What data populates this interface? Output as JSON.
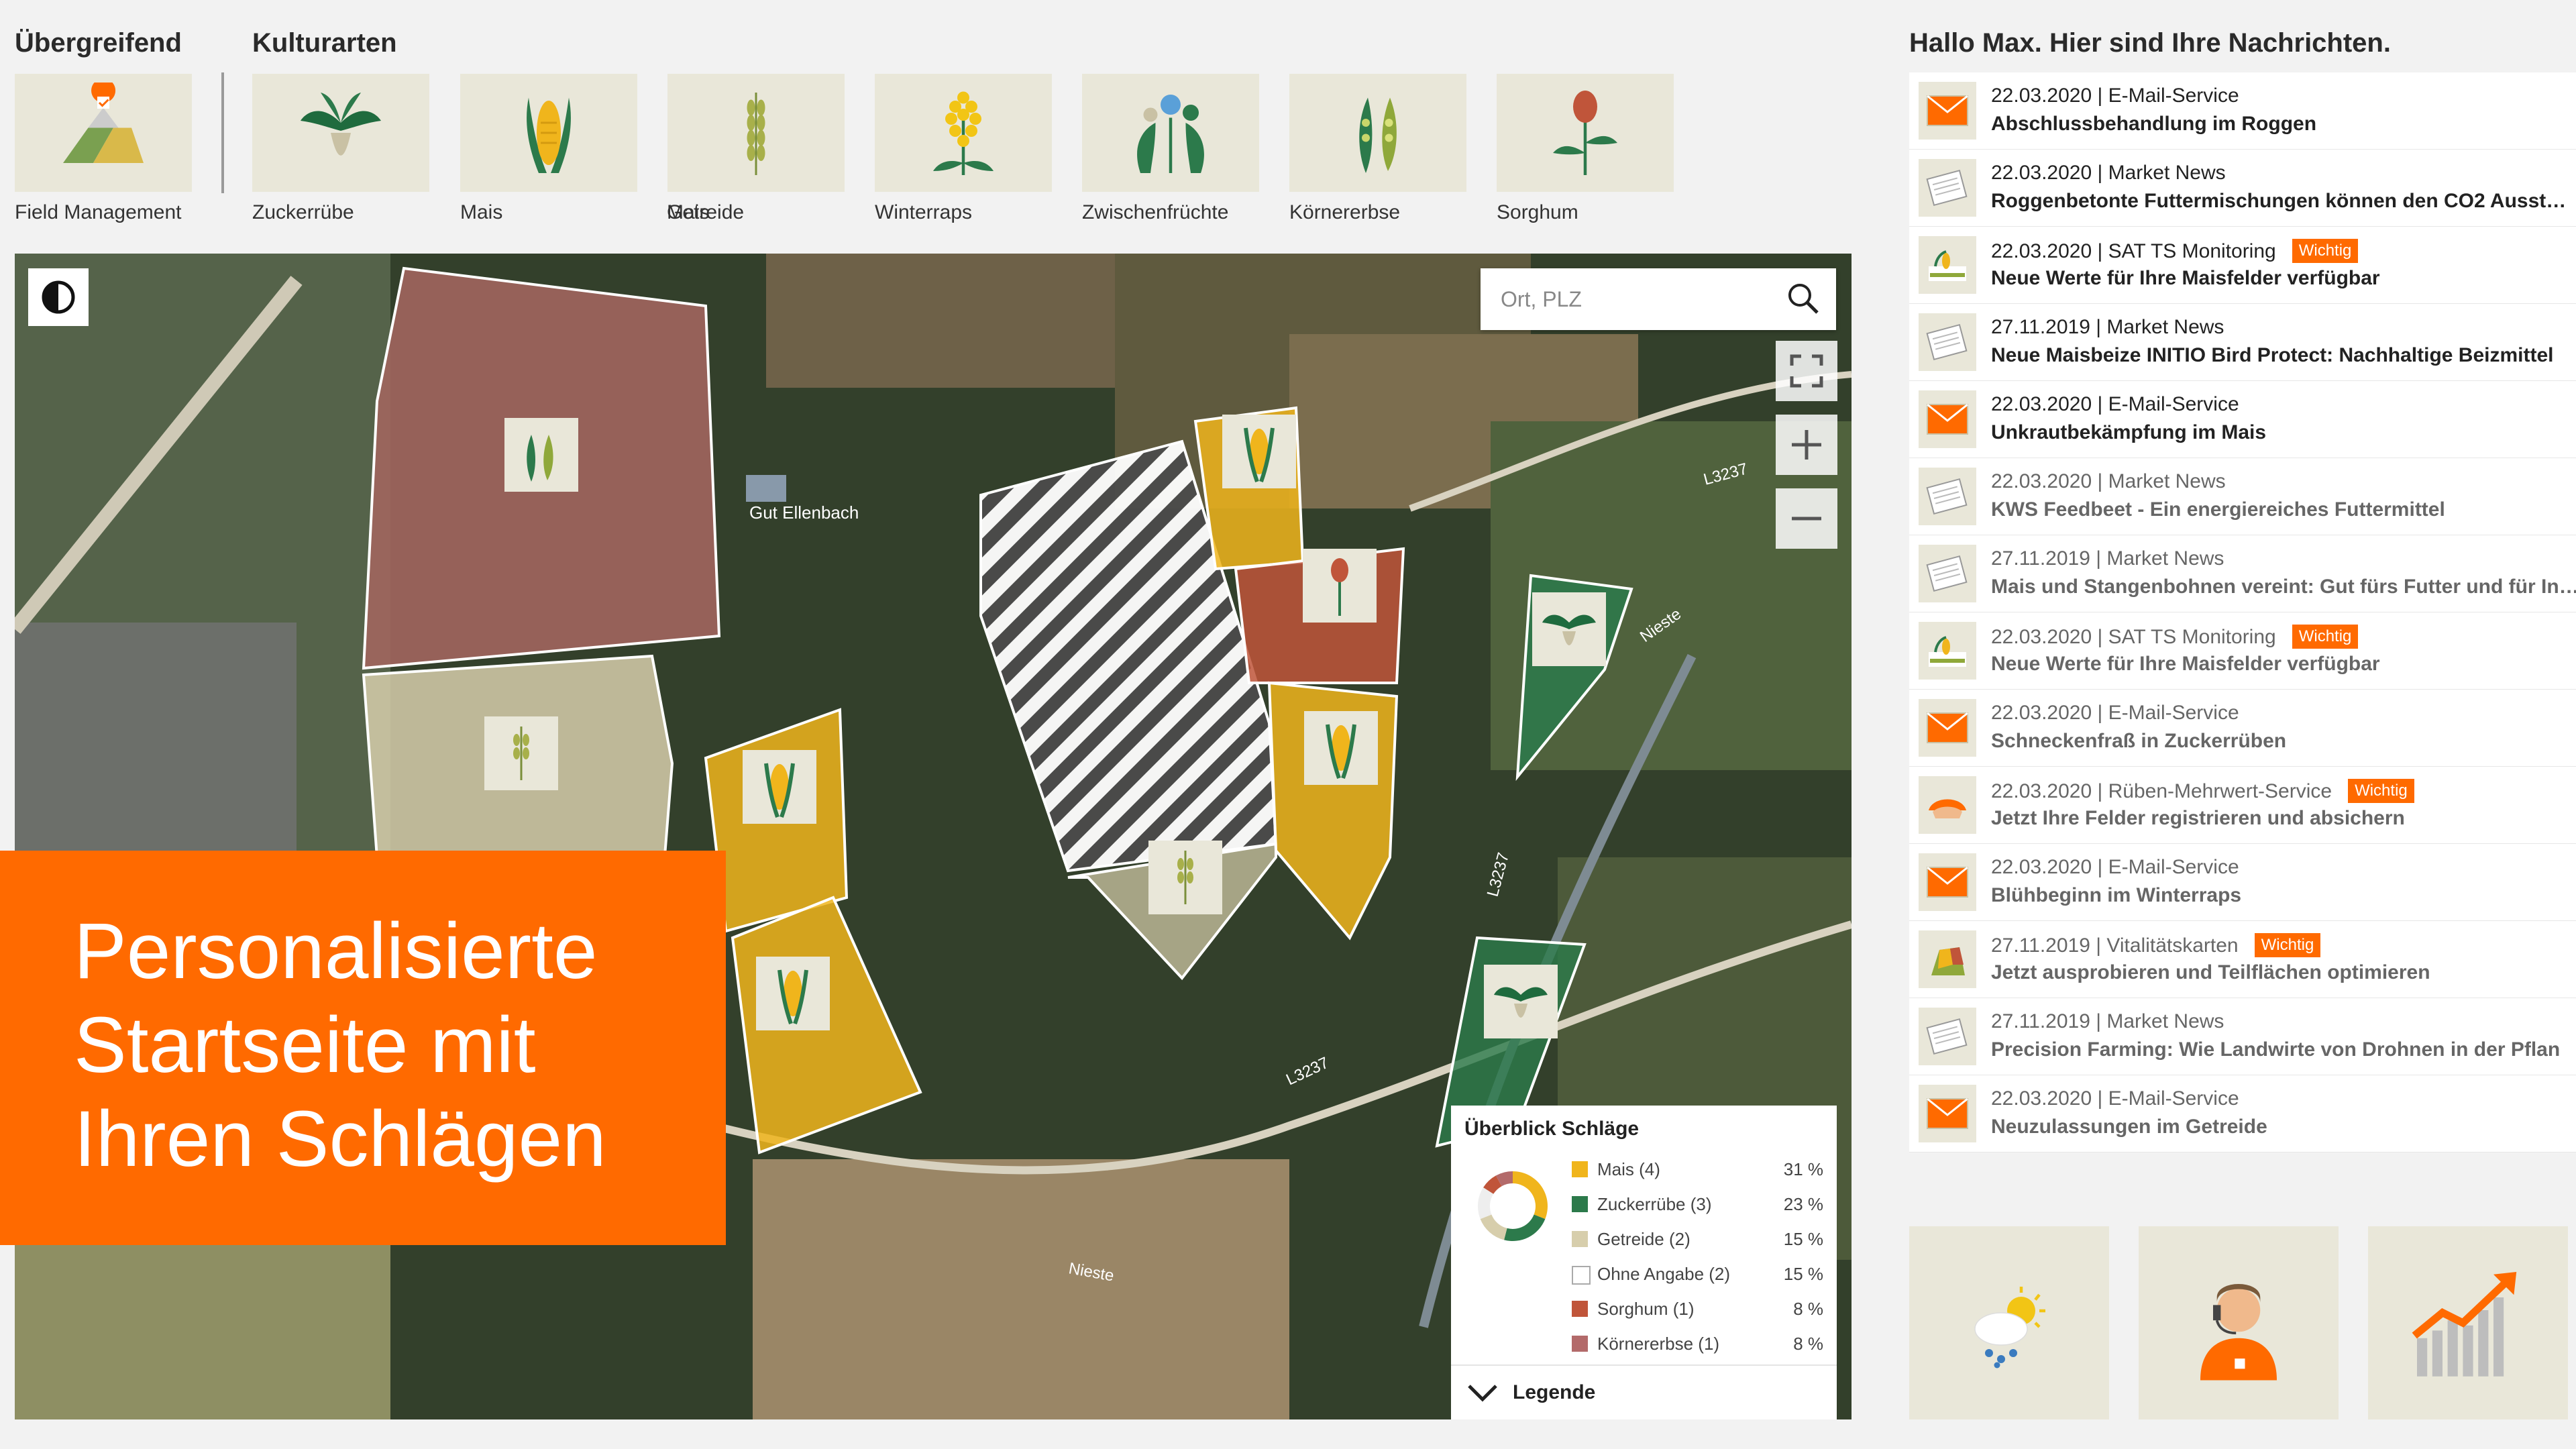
{
  "sections": {
    "overall_title": "Übergreifend",
    "cultures_title": "Kulturarten"
  },
  "tiles": [
    {
      "label": "Field Management",
      "icon": "field-management-icon"
    },
    {
      "label": "Zuckerrübe",
      "icon": "sugar-beet-icon"
    },
    {
      "label": "Mais",
      "icon": "corn-icon"
    },
    {
      "label": "Getreide",
      "icon": "grain-icon"
    },
    {
      "label": "Winterraps",
      "icon": "rapeseed-icon"
    },
    {
      "label": "Zwischenfrüchte",
      "icon": "cover-crop-icon"
    },
    {
      "label": "Körnererbse",
      "icon": "pea-icon"
    },
    {
      "label": "Sorghum",
      "icon": "sorghum-icon"
    }
  ],
  "map": {
    "search_placeholder": "Ort, PLZ",
    "place_labels": [
      "Gut Ellenbach",
      "L3237",
      "L3237",
      "L3237",
      "Nieste",
      "Nieste"
    ],
    "legend": {
      "title": "Überblick Schläge",
      "footer": "Legende",
      "items": [
        {
          "name": "Mais (4)",
          "pct": "31 %",
          "color": "#f0b51c"
        },
        {
          "name": "Zuckerrübe (3)",
          "pct": "23 %",
          "color": "#2c7a4b"
        },
        {
          "name": "Getreide (2)",
          "pct": "15 %",
          "color": "#d7ceac"
        },
        {
          "name": "Ohne Angabe (2)",
          "pct": "15 %",
          "color": "#ffffff"
        },
        {
          "name": "Sorghum (1)",
          "pct": "8 %",
          "color": "#c0553a"
        },
        {
          "name": "Körnererbse (1)",
          "pct": "8 %",
          "color": "#b36a6a"
        }
      ]
    }
  },
  "promo": {
    "line1": "Personalisierte",
    "line2": "Startseite mit",
    "line3": "Ihren Schlägen"
  },
  "messages": {
    "title": "Hallo Max. Hier sind Ihre Nachrichten.",
    "items": [
      {
        "meta": "22.03.2020 | E-Mail-Service",
        "subject": "Abschlussbehandlung im Roggen",
        "badge": "",
        "icon": "mail-icon",
        "read": false
      },
      {
        "meta": "22.03.2020 | Market News",
        "subject": "Roggenbetonte Futtermischungen können den CO2 Ausst…",
        "badge": "",
        "icon": "newspaper-icon",
        "read": false
      },
      {
        "meta": "22.03.2020 | SAT TS Monitoring",
        "subject": "Neue Werte für Ihre Maisfelder verfügbar",
        "badge": "Wichtig",
        "icon": "satellite-monitoring-icon",
        "read": false
      },
      {
        "meta": "27.11.2019 | Market News",
        "subject": "Neue Maisbeize INITIO Bird Protect: Nachhaltige Beizmittel",
        "badge": "",
        "icon": "newspaper-icon",
        "read": false
      },
      {
        "meta": "22.03.2020 | E-Mail-Service",
        "subject": "Unkrautbekämpfung im Mais",
        "badge": "",
        "icon": "mail-icon",
        "read": false
      },
      {
        "meta": "22.03.2020 | Market News",
        "subject": "KWS Feedbeet - Ein energiereiches Futtermittel",
        "badge": "",
        "icon": "newspaper-icon",
        "read": true
      },
      {
        "meta": "27.11.2019 | Market News",
        "subject": "Mais und Stangenbohnen vereint: Gut fürs Futter und für In…",
        "badge": "",
        "icon": "newspaper-icon",
        "read": true
      },
      {
        "meta": "22.03.2020 | SAT TS Monitoring",
        "subject": "Neue Werte für Ihre Maisfelder verfügbar",
        "badge": "Wichtig",
        "icon": "satellite-monitoring-icon",
        "read": true
      },
      {
        "meta": "22.03.2020 | E-Mail-Service",
        "subject": "Schneckenfraß in Zuckerrüben",
        "badge": "",
        "icon": "mail-icon",
        "read": true
      },
      {
        "meta": "22.03.2020 | Rüben-Mehrwert-Service",
        "subject": "Jetzt Ihre Felder registrieren und absichern",
        "badge": "Wichtig",
        "icon": "umbrella-icon",
        "read": true
      },
      {
        "meta": "22.03.2020 | E-Mail-Service",
        "subject": "Blühbeginn im Winterraps",
        "badge": "",
        "icon": "mail-icon",
        "read": true
      },
      {
        "meta": "27.11.2019 | Vitalitätskarten",
        "subject": "Jetzt ausprobieren und Teilflächen optimieren",
        "badge": "Wichtig",
        "icon": "vitality-map-icon",
        "read": true
      },
      {
        "meta": "27.11.2019 | Market News",
        "subject": "Precision Farming: Wie Landwirte von Drohnen in der Pflan",
        "badge": "",
        "icon": "newspaper-icon",
        "read": true
      },
      {
        "meta": "22.03.2020 | E-Mail-Service",
        "subject": "Neuzulassungen im Getreide",
        "badge": "",
        "icon": "mail-icon",
        "read": true
      }
    ]
  },
  "bottom_tiles": [
    {
      "icon": "weather-icon"
    },
    {
      "icon": "support-agent-icon"
    },
    {
      "icon": "market-chart-icon"
    }
  ],
  "colors": {
    "accent": "#ff6a00",
    "tile_bg": "#e9e7d9",
    "corn": "#f0b51c",
    "sugar_beet": "#2c7a4b"
  }
}
